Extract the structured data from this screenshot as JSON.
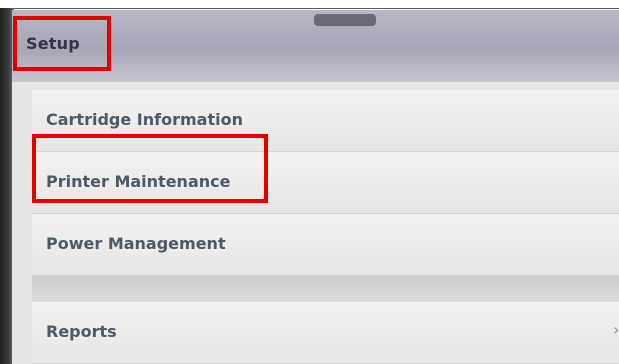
{
  "header": {
    "title": "Setup"
  },
  "menu": {
    "items": [
      {
        "label": "Cartridge Information"
      },
      {
        "label": "Printer Maintenance"
      },
      {
        "label": "Power Management"
      },
      {
        "label": "Reports"
      }
    ]
  },
  "colors": {
    "highlight": "#e00000",
    "header": "#aeadbd",
    "item_text": "#4b5a6b"
  }
}
